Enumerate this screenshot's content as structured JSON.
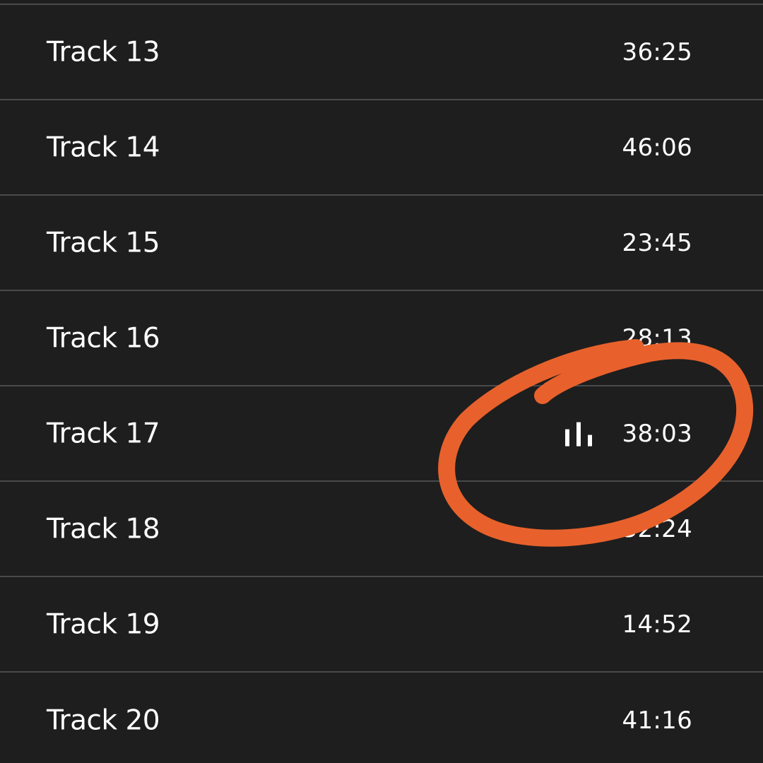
{
  "tracks": [
    {
      "title": "Track 13",
      "duration": "36:25"
    },
    {
      "title": "Track 14",
      "duration": "46:06"
    },
    {
      "title": "Track 15",
      "duration": "23:45"
    },
    {
      "title": "Track 16",
      "duration": "28:13"
    },
    {
      "title": "Track 17",
      "duration": "38:03",
      "playing": true
    },
    {
      "title": "Track 18",
      "duration": "32:24"
    },
    {
      "title": "Track 19",
      "duration": "14:52"
    },
    {
      "title": "Track 20",
      "duration": "41:16"
    }
  ],
  "now_playing_icon": "equalizer-bars-icon",
  "colors": {
    "background": "#1e1e1e",
    "divider": "#4a4a4a",
    "text": "#ffffff",
    "annotation": "#e8612c"
  }
}
